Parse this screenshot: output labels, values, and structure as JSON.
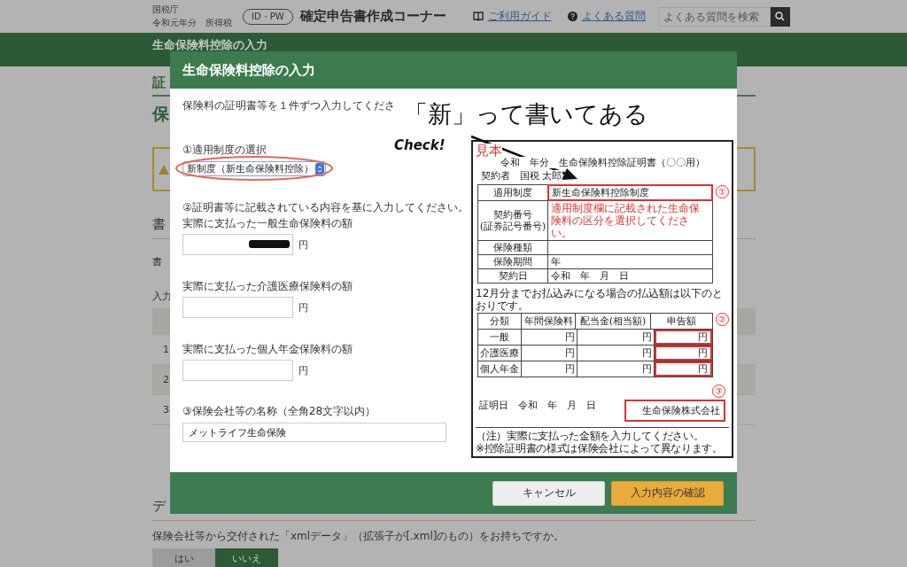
{
  "header": {
    "agency": "国税庁",
    "tax_year": "令和元年分　所得税",
    "badge": "ID・PW",
    "title": "確定申告書作成コーナー",
    "links": [
      {
        "label": "ご利用ガイド"
      },
      {
        "label": "よくある質問"
      }
    ],
    "search": {
      "placeholder": "よくある質問を検索"
    }
  },
  "page_bar": {
    "title": "生命保険料控除の入力"
  },
  "page": {
    "heading": "証",
    "title": "保",
    "section_heading": "書",
    "section_text": "書",
    "table_label": "入力",
    "table_rows": [
      "1",
      "2",
      "3"
    ],
    "data_heading": "デ",
    "xml_question": "保険会社等から交付された「xmlデータ」（拡張子が[.xml]のもの）をお持ちですか。",
    "xml_choices": [
      {
        "label": "はい",
        "selected": false
      },
      {
        "label": "いいえ",
        "selected": true
      }
    ]
  },
  "dialog": {
    "title": "生命保険料控除の入力",
    "intro": "保険料の証明書等を１件ずつ入力してくださ",
    "system": {
      "label": "①適用制度の選択",
      "value": "新制度（新生命保険料控除）"
    },
    "amounts_heading": "②証明書等に記載されている内容を基に入力してください。",
    "amounts": [
      {
        "label": "実際に支払った一般生命保険料の額",
        "redacted": true,
        "unit": "円"
      },
      {
        "label": "実際に支払った介護医療保険料の額",
        "redacted": false,
        "unit": "円"
      },
      {
        "label": "実際に支払った個人年金保険料の額",
        "redacted": false,
        "unit": "円"
      }
    ],
    "company": {
      "label": "③保険会社等の名称（全角28文字以内）",
      "value": "メットライフ生命保険"
    },
    "sample": {
      "stamp": "見本",
      "title": "令和　年分　生命保険料控除証明書（〇〇用）",
      "holder": "契約者　国税 太郎",
      "contract_rows": [
        {
          "label": "適用制度",
          "value": "新生命保険料控除制度",
          "marker": "①"
        },
        {
          "label": "契約番号",
          "sublabel": "(証券記号番号)",
          "note": "適用制度欄に記載された生命保険料の区分を選択してください。"
        },
        {
          "label": "保険種類"
        },
        {
          "label": "保険期間",
          "value": "年"
        },
        {
          "label": "契約日",
          "value": "令和　年　月　日"
        }
      ],
      "payment_text": "12月分までお払込みになる場合の払込額は以下のとおりです。",
      "payment_columns": [
        "分類",
        "年間保険料",
        "配当金(相当額)",
        "申告額"
      ],
      "payment_rows": [
        [
          "一般",
          "円",
          "円",
          "円"
        ],
        [
          "介護医療",
          "円",
          "円",
          "円"
        ],
        [
          "個人年金",
          "円",
          "円",
          "円"
        ]
      ],
      "payment_marker": "②",
      "date": "証明日　令和　年　月　日",
      "company": "生命保険株式会社",
      "company_marker": "③",
      "notes": [
        "（注）実際に支払った金額を入力してください。",
        "※控除証明書の様式は保険会社によって異なります。"
      ]
    },
    "buttons": [
      {
        "label": "キャンセル",
        "kind": "secondary"
      },
      {
        "label": "入力内容の確認",
        "kind": "primary"
      }
    ]
  },
  "annotations": {
    "caption": "「新」って書いてある",
    "check": "Check!"
  }
}
